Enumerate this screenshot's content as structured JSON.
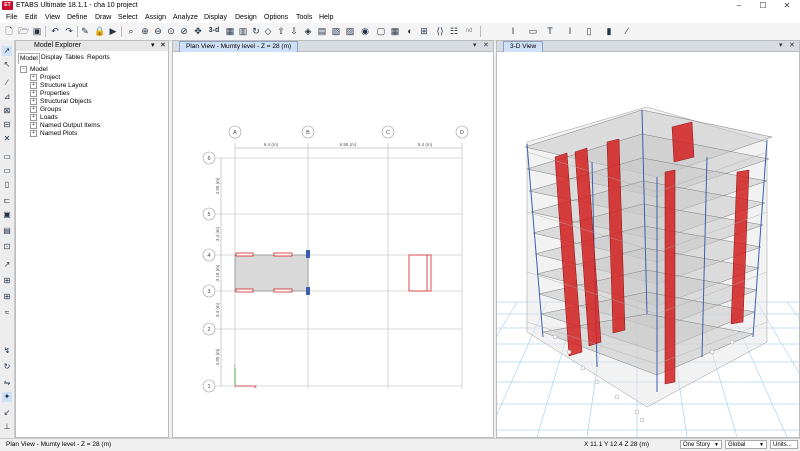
{
  "window": {
    "title": "ETABS Ultimate 18.1.1 - cha 10 project",
    "logo": "ET",
    "controls": [
      "minimize-icon",
      "maximize-icon",
      "close-icon"
    ]
  },
  "menu": [
    "File",
    "Edit",
    "View",
    "Define",
    "Draw",
    "Select",
    "Assign",
    "Analyze",
    "Display",
    "Design",
    "Options",
    "Tools",
    "Help"
  ],
  "toolbar": {
    "view_3d_label": "3-d",
    "nd_label": "nd"
  },
  "model_explorer": {
    "title": "Model Explorer",
    "tabs": [
      "Model",
      "Display",
      "Tables",
      "Reports"
    ],
    "root": "Model",
    "items": [
      "Project",
      "Structure Layout",
      "Properties",
      "Structural Objects",
      "Groups",
      "Loads",
      "Named Output Items",
      "Named Plots"
    ]
  },
  "plan_view": {
    "tab_title": "Plan View - Mumty level - Z = 28 (m)",
    "x_grids": [
      "A",
      "B",
      "C",
      "D"
    ],
    "y_grids": [
      "6",
      "5",
      "4",
      "3",
      "2",
      "1"
    ],
    "x_dims": [
      "6.4 (m)",
      "6.95 (m)",
      "6.4 (m)"
    ],
    "y_dims": [
      "4.95 (m)",
      "3.4 (m)",
      "3.18 (m)",
      "3.4 (m)",
      "4.95 (m)"
    ]
  },
  "view_3d": {
    "tab_title": "3-D View"
  },
  "statusbar": {
    "text": "Plan View - Mumty level - Z = 28 (m)",
    "coords": "X 11.1  Y 12.4  Z 28 (m)",
    "story_option": "One Story",
    "coord_system": "Global",
    "units_label": "Units..."
  },
  "colors": {
    "frame_red": "#d42020",
    "column_blue": "#3a5fb0",
    "shell_gray": "#c8c8c8",
    "grid_blue": "#6fa6d8"
  }
}
